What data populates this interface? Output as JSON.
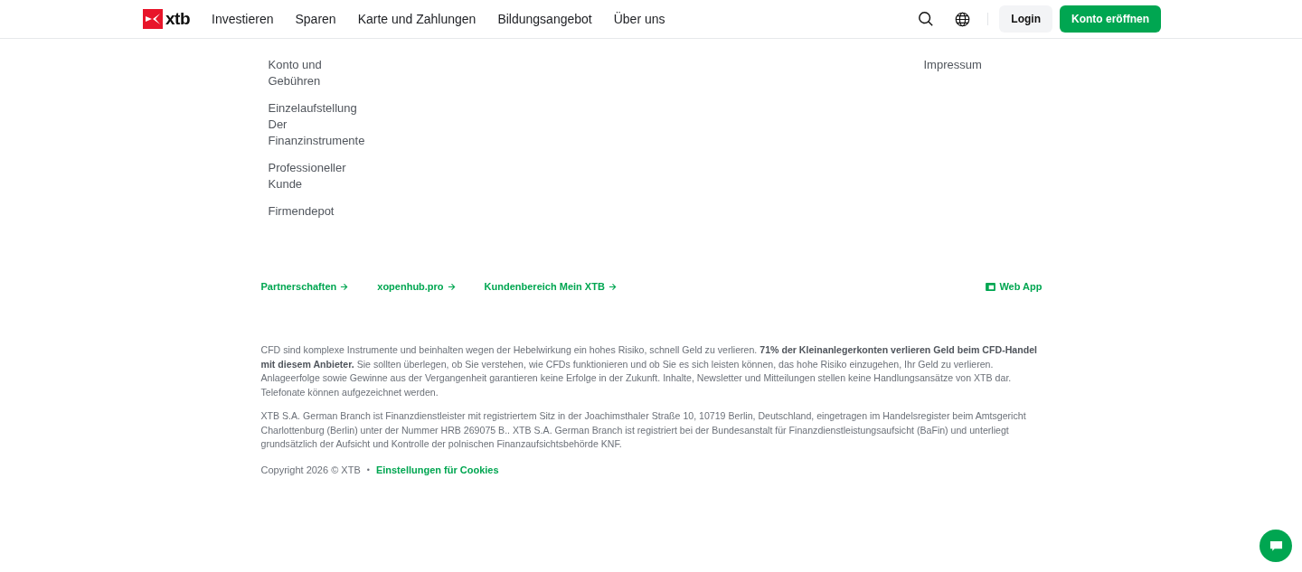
{
  "header": {
    "logo_text": "xtb",
    "nav": [
      {
        "label": "Investieren"
      },
      {
        "label": "Sparen"
      },
      {
        "label": "Karte und Zahlungen"
      },
      {
        "label": "Bildungsangebot"
      },
      {
        "label": "Über uns"
      }
    ],
    "login": "Login",
    "cta": "Konto eröffnen"
  },
  "footer_columns": [
    {
      "items": [
        "Konto und Gebühren",
        "Einzelaufstellung Der Finanzinstrumente",
        "Professioneller Kunde",
        "Firmendepot"
      ]
    },
    {
      "items": [
        "Impressum"
      ]
    }
  ],
  "links": [
    {
      "label": "Partnerschaften",
      "kind": "arrow"
    },
    {
      "label": "xopenhub.pro",
      "kind": "arrow"
    },
    {
      "label": "Kundenbereich Mein XTB",
      "kind": "arrow"
    },
    {
      "label": "Web App",
      "kind": "app"
    }
  ],
  "disclaimer": [
    "CFD sind komplexe Instrumente und beinhalten wegen der Hebelwirkung ein hohes Risiko, schnell Geld zu verlieren. **71% der Kleinanlegerkonten verlieren Geld beim CFD-Handel mit diesem Anbieter.** Sie sollten überlegen, ob Sie verstehen, wie CFDs funktionieren und ob Sie es sich leisten können, das hohe Risiko einzugehen, Ihr Geld zu verlieren. Anlageerfolge sowie Gewinne aus der Vergangenheit garantieren keine Erfolge in der Zukunft. Inhalte, Newsletter und Mitteilungen stellen keine Handlungsansätze von XTB dar. Telefonate können aufgezeichnet werden.",
    "XTB S.A. German Branch ist Finanzdienstleister mit registriertem Sitz in der Joachimsthaler Straße 10, 10719 Berlin, Deutschland, eingetragen im Handelsregister beim Amtsgericht Charlottenburg (Berlin) unter der Nummer HRB 269075 B.. XTB S.A. German Branch ist registriert bei der Bundesanstalt für Finanzdienstleistungsaufsicht (BaFin) und unterliegt grundsätzlich der Aufsicht und Kontrolle der polnischen Finanzaufsichtsbehörde KNF."
  ],
  "copyright": "Copyright 2026 © XTB",
  "separator": "•",
  "cookies_link": "Einstellungen für Cookies"
}
